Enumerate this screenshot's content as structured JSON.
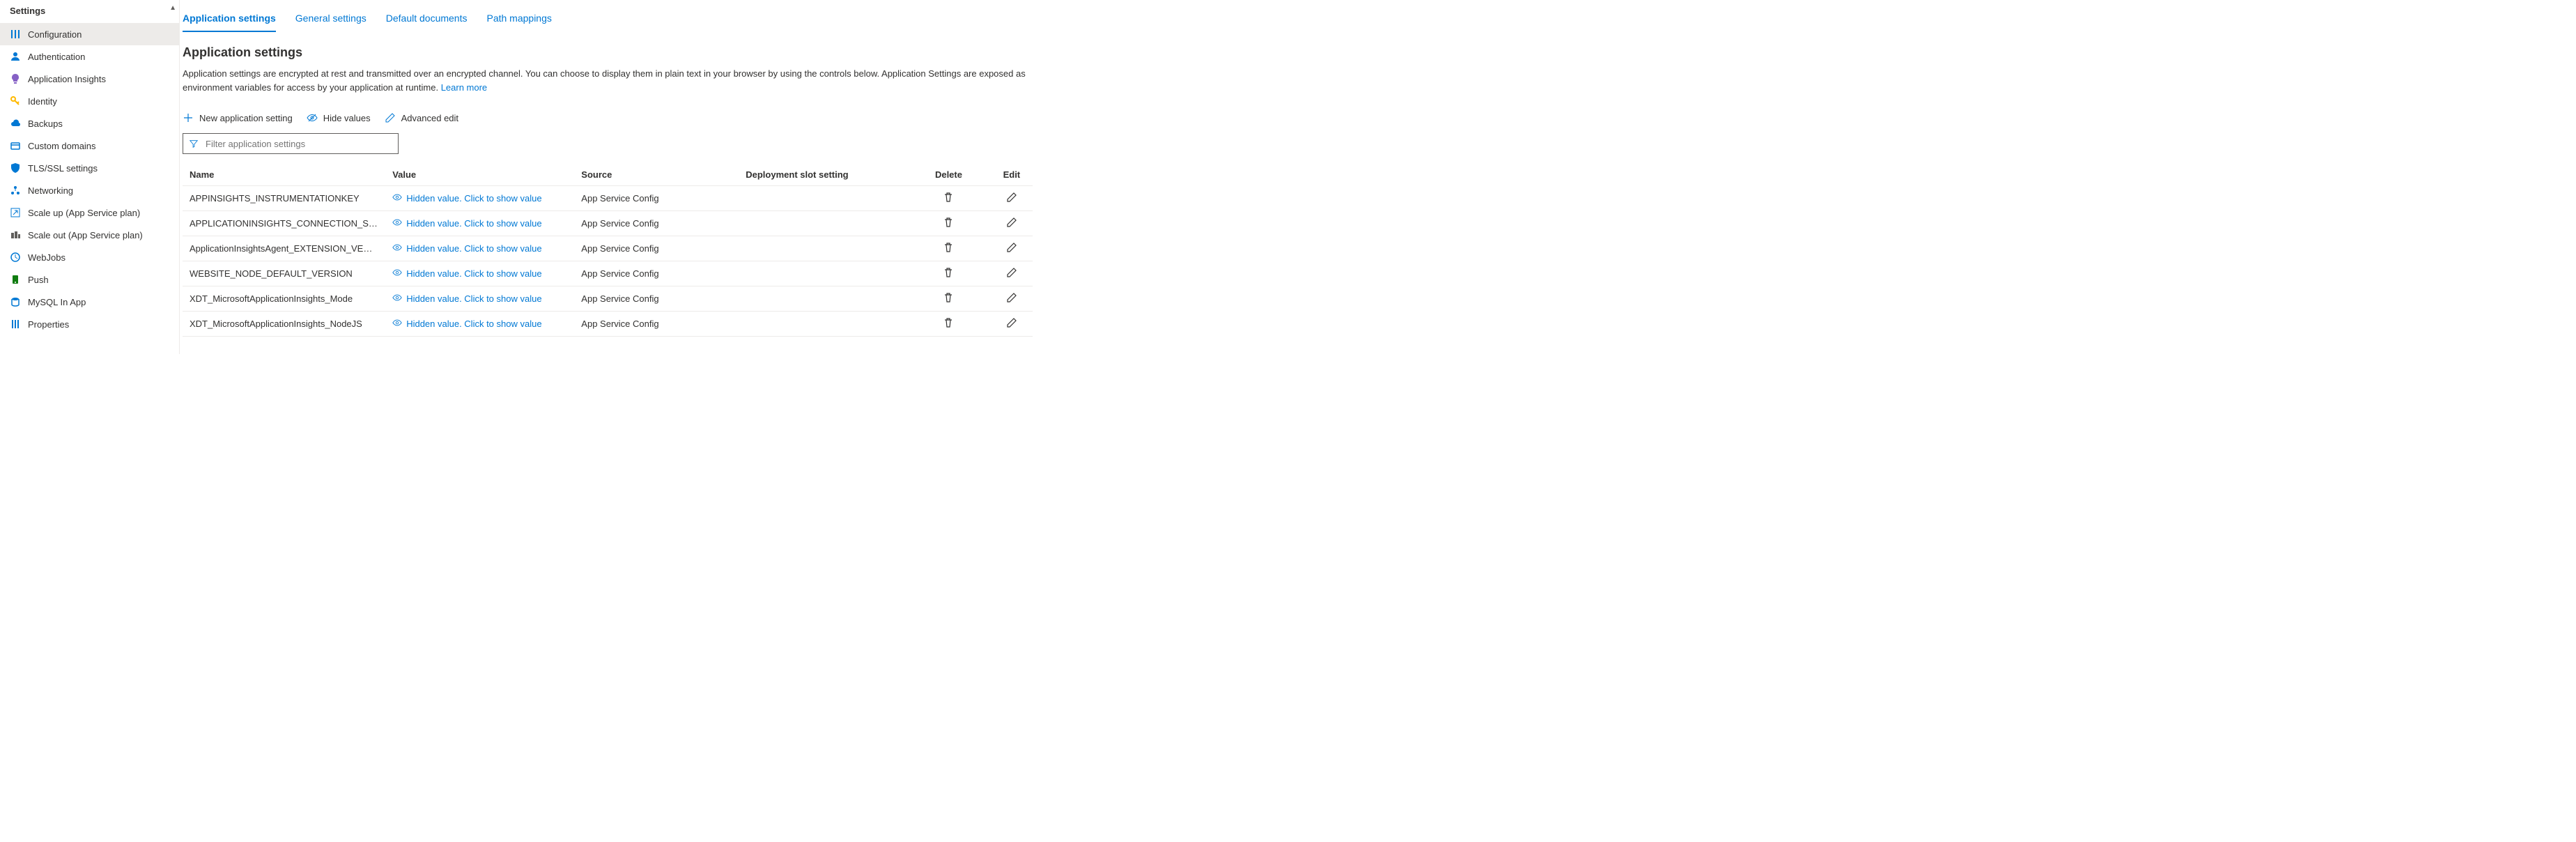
{
  "sidebar": {
    "header": "Settings",
    "items": [
      {
        "label": "Configuration",
        "icon": "sliders",
        "color": "#0078d4",
        "active": true
      },
      {
        "label": "Authentication",
        "icon": "person",
        "color": "#0078d4",
        "active": false
      },
      {
        "label": "Application Insights",
        "icon": "bulb",
        "color": "#8661c5",
        "active": false
      },
      {
        "label": "Identity",
        "icon": "key",
        "color": "#ffb900",
        "active": false
      },
      {
        "label": "Backups",
        "icon": "cloud",
        "color": "#0078d4",
        "active": false
      },
      {
        "label": "Custom domains",
        "icon": "domain",
        "color": "#0078d4",
        "active": false
      },
      {
        "label": "TLS/SSL settings",
        "icon": "shield",
        "color": "#0078d4",
        "active": false
      },
      {
        "label": "Networking",
        "icon": "network",
        "color": "#0078d4",
        "active": false
      },
      {
        "label": "Scale up (App Service plan)",
        "icon": "scaleup",
        "color": "#0078d4",
        "active": false
      },
      {
        "label": "Scale out (App Service plan)",
        "icon": "scaleout",
        "color": "#605e5c",
        "active": false
      },
      {
        "label": "WebJobs",
        "icon": "webjobs",
        "color": "#0078d4",
        "active": false
      },
      {
        "label": "Push",
        "icon": "push",
        "color": "#107c10",
        "active": false
      },
      {
        "label": "MySQL In App",
        "icon": "mysql",
        "color": "#0078d4",
        "active": false
      },
      {
        "label": "Properties",
        "icon": "properties",
        "color": "#0078d4",
        "active": false
      }
    ]
  },
  "tabs": [
    {
      "label": "Application settings",
      "active": true
    },
    {
      "label": "General settings",
      "active": false
    },
    {
      "label": "Default documents",
      "active": false
    },
    {
      "label": "Path mappings",
      "active": false
    }
  ],
  "section": {
    "title": "Application settings",
    "description": "Application settings are encrypted at rest and transmitted over an encrypted channel. You can choose to display them in plain text in your browser by using the controls below. Application Settings are exposed as environment variables for access by your application at runtime. ",
    "learn_more": "Learn more"
  },
  "toolbar": {
    "new_setting": "New application setting",
    "hide_values": "Hide values",
    "advanced_edit": "Advanced edit"
  },
  "filter": {
    "placeholder": "Filter application settings"
  },
  "table": {
    "headers": {
      "name": "Name",
      "value": "Value",
      "source": "Source",
      "slot": "Deployment slot setting",
      "delete": "Delete",
      "edit": "Edit"
    },
    "hidden_value_text": "Hidden value. Click to show value",
    "rows": [
      {
        "name": "APPINSIGHTS_INSTRUMENTATIONKEY",
        "source": "App Service Config"
      },
      {
        "name": "APPLICATIONINSIGHTS_CONNECTION_STRING",
        "source": "App Service Config"
      },
      {
        "name": "ApplicationInsightsAgent_EXTENSION_VERSION",
        "source": "App Service Config"
      },
      {
        "name": "WEBSITE_NODE_DEFAULT_VERSION",
        "source": "App Service Config"
      },
      {
        "name": "XDT_MicrosoftApplicationInsights_Mode",
        "source": "App Service Config"
      },
      {
        "name": "XDT_MicrosoftApplicationInsights_NodeJS",
        "source": "App Service Config"
      }
    ]
  }
}
